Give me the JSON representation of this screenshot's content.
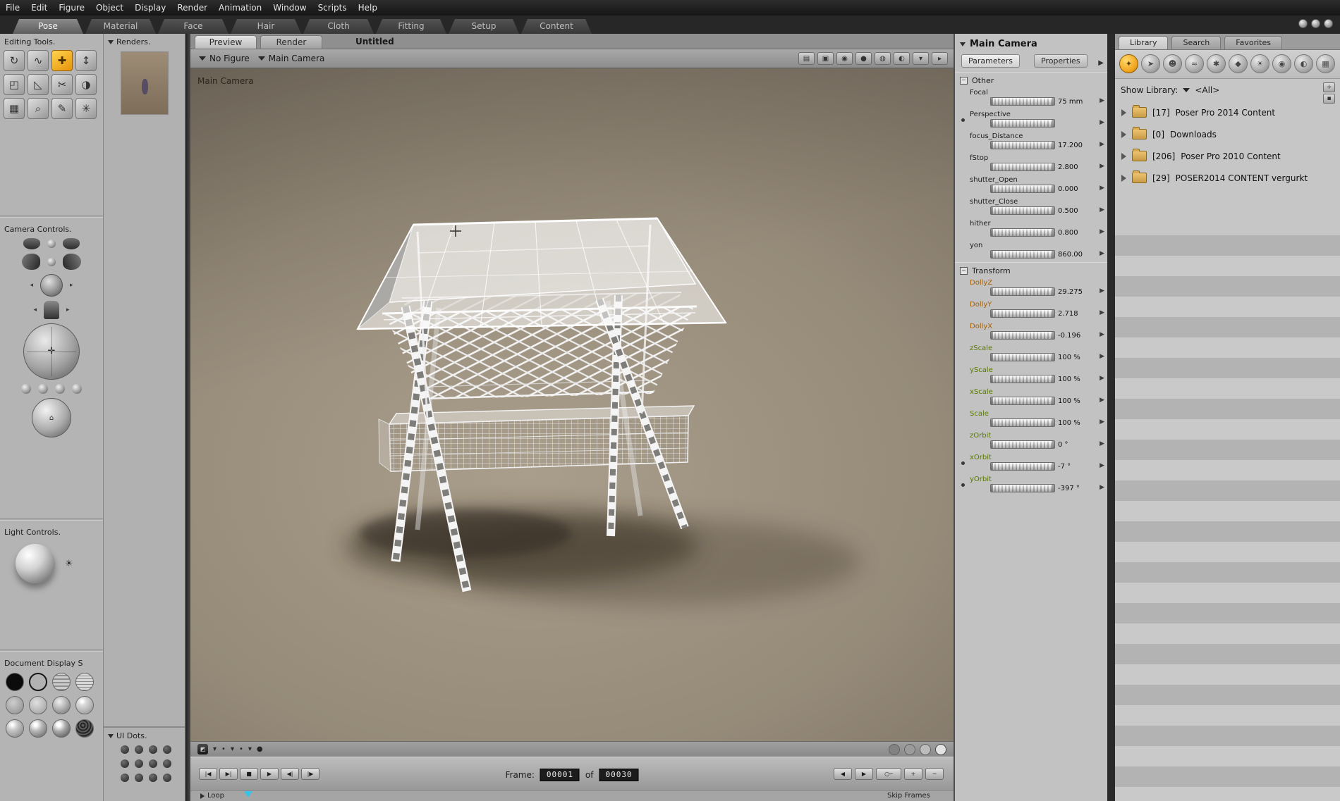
{
  "menu": {
    "items": [
      "File",
      "Edit",
      "Figure",
      "Object",
      "Display",
      "Render",
      "Animation",
      "Window",
      "Scripts",
      "Help"
    ]
  },
  "room_tabs": {
    "selected": "Pose",
    "items": [
      "Pose",
      "Material",
      "Face",
      "Hair",
      "Cloth",
      "Fitting",
      "Setup",
      "Content"
    ]
  },
  "left_panel": {
    "editing_tools": {
      "title": "Editing Tools.",
      "tools": [
        {
          "name": "rotate",
          "glyph": "↻"
        },
        {
          "name": "twist",
          "glyph": "∿"
        },
        {
          "name": "translate-pull",
          "glyph": "✚",
          "selected": true
        },
        {
          "name": "translate-in-out",
          "glyph": "↕"
        },
        {
          "name": "scale",
          "glyph": "◰"
        },
        {
          "name": "taper",
          "glyph": "◺"
        },
        {
          "name": "chain-break",
          "glyph": "✂"
        },
        {
          "name": "color",
          "glyph": "◑"
        },
        {
          "name": "grouping",
          "glyph": "▦"
        },
        {
          "name": "view-magnifier",
          "glyph": "⌕"
        },
        {
          "name": "morphing-tool",
          "glyph": "✎"
        },
        {
          "name": "direct-manipulation",
          "glyph": "✳"
        }
      ]
    },
    "camera_controls": {
      "title": "Camera Controls."
    },
    "light_controls": {
      "title": "Light Controls."
    },
    "document_display": {
      "title": "Document Display S"
    },
    "display_styles": [
      "silhouette",
      "outline",
      "wireframe",
      "hidden-line",
      "lit-wireframe",
      "flat-shaded",
      "flat-lined",
      "cartoon",
      "smooth-shaded",
      "smooth-lined",
      "texture-shaded",
      "shadow"
    ]
  },
  "renders_panel": {
    "title": "Renders."
  },
  "ui_dots": {
    "title": "UI Dots."
  },
  "document": {
    "tabs": [
      {
        "label": "Preview",
        "selected": true
      },
      {
        "label": "Render",
        "selected": false
      }
    ],
    "title": "Untitled",
    "figure_selector": "No Figure",
    "camera_selector": "Main Camera",
    "viewport_label": "Main Camera",
    "toolbar_icons": [
      {
        "name": "view-panes-icon",
        "glyph": "▤"
      },
      {
        "name": "camera-view-icon",
        "glyph": "▣"
      },
      {
        "name": "orbit-icon",
        "glyph": "◉"
      },
      {
        "name": "ball-dark-icon",
        "glyph": "●"
      },
      {
        "name": "ball-light-icon",
        "glyph": "◍"
      },
      {
        "name": "half-shaded-ball-icon",
        "glyph": "◐"
      },
      {
        "name": "dropdown-icon",
        "glyph": "▾"
      },
      {
        "name": "flyout-icon",
        "glyph": "▸"
      }
    ]
  },
  "display_bar": {
    "left_icons": [
      {
        "name": "corner-toggle-icon",
        "glyph": "◩",
        "square": true
      },
      {
        "name": "dropdown-1-icon",
        "glyph": "▾"
      },
      {
        "name": "dot-1-icon",
        "glyph": "•"
      },
      {
        "name": "dropdown-2-icon",
        "glyph": "▾"
      },
      {
        "name": "dot-2-icon",
        "glyph": "•"
      },
      {
        "name": "dropdown-3-icon",
        "glyph": "▾"
      },
      {
        "name": "ball-icon",
        "glyph": "●"
      }
    ],
    "style_circles": [
      "preview-style-dark",
      "preview-style-mid",
      "preview-style-light",
      "preview-style-lit"
    ]
  },
  "animation": {
    "transport": [
      {
        "name": "first-frame",
        "glyph": "|◀"
      },
      {
        "name": "last-frame",
        "glyph": "▶|"
      },
      {
        "name": "stop",
        "glyph": "■"
      },
      {
        "name": "play",
        "glyph": "▶"
      },
      {
        "name": "prev-frame",
        "glyph": "◀|"
      },
      {
        "name": "next-frame",
        "glyph": "|▶"
      }
    ],
    "frame_label": "Frame:",
    "current_frame": "00001",
    "of_label": "of",
    "total_frames": "00030",
    "right_controls": [
      {
        "name": "step-back",
        "glyph": "◀"
      },
      {
        "name": "step-forward",
        "glyph": "▶"
      },
      {
        "name": "edit-keyframes",
        "glyph": "○─",
        "wide": true
      },
      {
        "name": "add-keyframe",
        "glyph": "+"
      },
      {
        "name": "delete-keyframe",
        "glyph": "−"
      }
    ],
    "loop_label": "Loop",
    "skip_frames_label": "Skip Frames"
  },
  "parameters_panel": {
    "title": "Main Camera",
    "tabs": [
      {
        "label": "Parameters",
        "selected": true
      },
      {
        "label": "Properties",
        "selected": false
      }
    ],
    "groups": [
      {
        "name": "Other",
        "params": [
          {
            "label": "Focal",
            "value": "75 mm",
            "color": "black",
            "marker": false
          },
          {
            "label": "Perspective",
            "value": "",
            "color": "black",
            "marker": true
          },
          {
            "label": "focus_Distance",
            "value": "17.200",
            "color": "black",
            "marker": false
          },
          {
            "label": "fStop",
            "value": "2.800",
            "color": "black",
            "marker": false
          },
          {
            "label": "shutter_Open",
            "value": "0.000",
            "color": "black",
            "marker": false
          },
          {
            "label": "shutter_Close",
            "value": "0.500",
            "color": "black",
            "marker": false
          },
          {
            "label": "hither",
            "value": "0.800",
            "color": "black",
            "marker": false
          },
          {
            "label": "yon",
            "value": "860.00",
            "color": "black",
            "marker": false
          }
        ]
      },
      {
        "name": "Transform",
        "params": [
          {
            "label": "DollyZ",
            "value": "29.275",
            "color": "orange",
            "marker": false
          },
          {
            "label": "DollyY",
            "value": "2.718",
            "color": "orange",
            "marker": false
          },
          {
            "label": "DollyX",
            "value": "-0.196",
            "color": "orange",
            "marker": false
          },
          {
            "label": "zScale",
            "value": "100 %",
            "color": "green",
            "marker": false
          },
          {
            "label": "yScale",
            "value": "100 %",
            "color": "green",
            "marker": false
          },
          {
            "label": "xScale",
            "value": "100 %",
            "color": "green",
            "marker": false
          },
          {
            "label": "Scale",
            "value": "100 %",
            "color": "green",
            "marker": false
          },
          {
            "label": "zOrbit",
            "value": "0 °",
            "color": "green",
            "marker": false
          },
          {
            "label": "xOrbit",
            "value": "-7 °",
            "color": "green",
            "marker": true
          },
          {
            "label": "yOrbit",
            "value": "-397 °",
            "color": "green",
            "marker": true
          }
        ]
      }
    ]
  },
  "library_panel": {
    "tabs": [
      {
        "label": "Library",
        "selected": true
      },
      {
        "label": "Search",
        "selected": false
      },
      {
        "label": "Favorites",
        "selected": false
      }
    ],
    "categories": [
      {
        "name": "figures",
        "glyph": "✦",
        "selected": true
      },
      {
        "name": "poses",
        "glyph": "➤"
      },
      {
        "name": "expression",
        "glyph": "☻"
      },
      {
        "name": "hair",
        "glyph": "≈"
      },
      {
        "name": "hands",
        "glyph": "✱"
      },
      {
        "name": "props",
        "glyph": "◆"
      },
      {
        "name": "lights",
        "glyph": "☀"
      },
      {
        "name": "cameras",
        "glyph": "◉"
      },
      {
        "name": "materials",
        "glyph": "◐"
      },
      {
        "name": "scenes",
        "glyph": "▦"
      }
    ],
    "show_library_label": "Show Library:",
    "show_library_value": "<All>",
    "folders": [
      {
        "count": "[17]",
        "name": "Poser Pro 2014 Content"
      },
      {
        "count": "[0]",
        "name": "Downloads"
      },
      {
        "count": "[206]",
        "name": "Poser Pro 2010 Content"
      },
      {
        "count": "[29]",
        "name": "POSER2014 CONTENT vergurkt"
      }
    ]
  },
  "colors": {
    "accent_orange": "#e8a020",
    "param_orange": "#a85f00",
    "param_green": "#587a00",
    "viewport_brown": "#968b79",
    "timeline_cyan": "#35c4e8"
  }
}
